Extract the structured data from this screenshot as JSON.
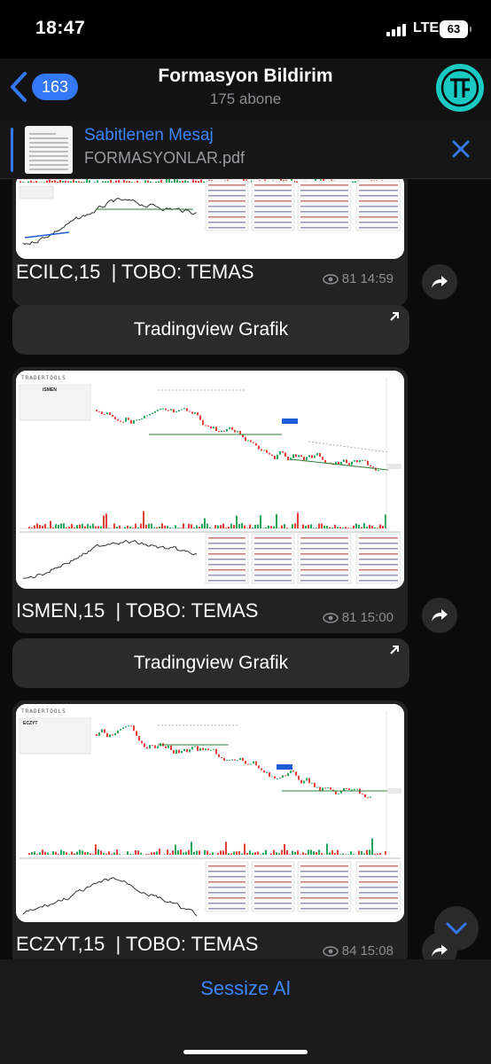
{
  "status_bar": {
    "time": "18:47",
    "network": "LTE",
    "battery": "63"
  },
  "header": {
    "back_count": "163",
    "title": "Formasyon Bildirim",
    "subtitle": "175 abone"
  },
  "pinned": {
    "title": "Sabitlenen Mesaj",
    "file": "FORMASYONLAR.pdf"
  },
  "messages": [
    {
      "caption": "ECILC,15  | TOBO: TEMAS",
      "views": "81",
      "time": "14:59"
    },
    {
      "caption": "ISMEN,15  | TOBO: TEMAS",
      "views": "81",
      "time": "15:00",
      "chart_symbol": "ISMEN"
    },
    {
      "caption": "ECZYT,15  | TOBO: TEMAS",
      "views": "84",
      "time": "15:08",
      "chart_symbol": "ECZYT"
    }
  ],
  "link_buttons": [
    {
      "label": "Tradingview Grafik"
    },
    {
      "label": "Tradingview Grafik"
    }
  ],
  "chart_brand": "TRADERTOOLS",
  "bottom": {
    "mute_label": "Sessize Al"
  },
  "colors": {
    "accent": "#3478f6",
    "avatar": "#19c9c4",
    "candle_up": "#26a65b",
    "candle_down": "#e5413b"
  }
}
